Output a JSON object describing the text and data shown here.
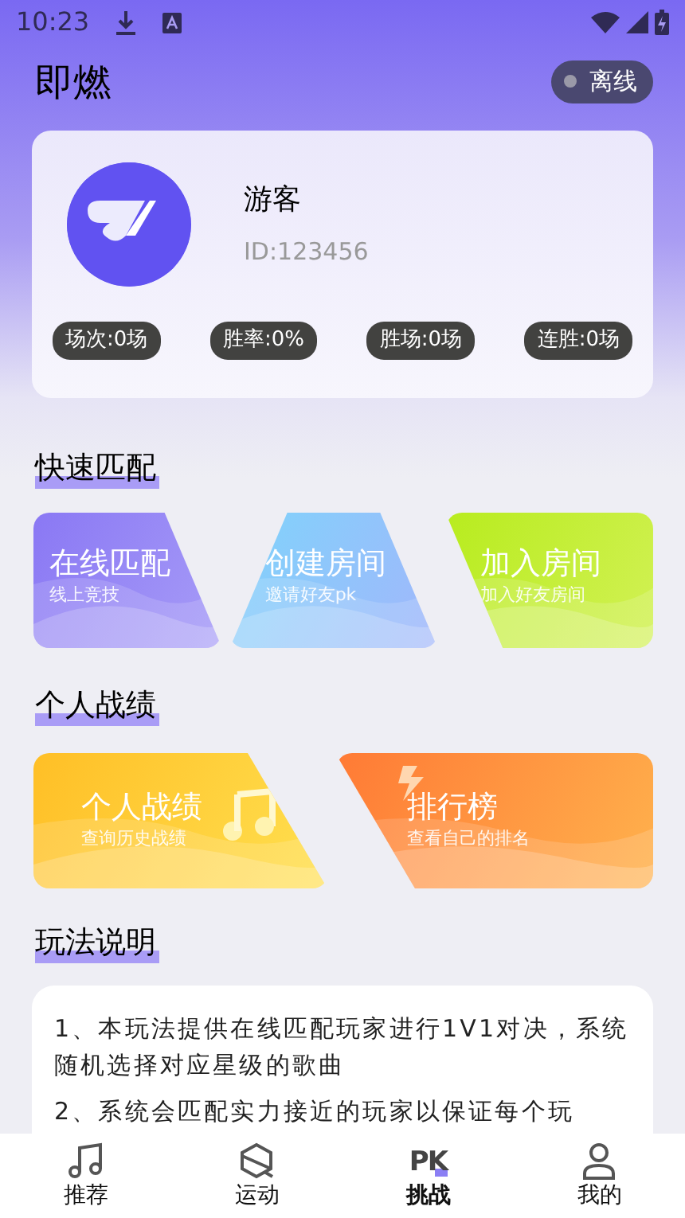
{
  "status_bar": {
    "time": "10:23"
  },
  "header": {
    "title": "即燃",
    "status": {
      "label": "离线",
      "online": false
    }
  },
  "profile": {
    "name": "游客",
    "id": "ID:123456",
    "stats": [
      "场次:0场",
      "胜率:0%",
      "胜场:0场",
      "连胜:0场"
    ]
  },
  "sections": [
    {
      "title": "快速匹配",
      "cards": [
        {
          "title": "在线匹配",
          "subtitle": "线上竞技",
          "kind": "purple"
        },
        {
          "title": "创建房间",
          "subtitle": "邀请好友pk",
          "kind": "blue"
        },
        {
          "title": "加入房间",
          "subtitle": "加入好友房间",
          "kind": "green"
        }
      ]
    },
    {
      "title": "个人战绩",
      "cards": [
        {
          "title": "个人战绩",
          "subtitle": "查询历史战绩",
          "kind": "yellow"
        },
        {
          "title": "排行榜",
          "subtitle": "查看自己的排名",
          "kind": "orange"
        }
      ]
    }
  ],
  "rules": {
    "title": "玩法说明",
    "items": [
      "1、本玩法提供在线匹配玩家进行1V1对决，系统随机选择对应星级的歌曲",
      "2、系统会匹配实力接近的玩家以保证每个玩"
    ]
  },
  "bottom_nav": [
    {
      "label": "推荐",
      "kind": "music",
      "selected": false
    },
    {
      "label": "运动",
      "kind": "sport",
      "selected": false
    },
    {
      "label": "挑战",
      "kind": "pk",
      "icon_text": "PK",
      "selected": true
    },
    {
      "label": "我的",
      "kind": "person",
      "selected": false
    }
  ]
}
